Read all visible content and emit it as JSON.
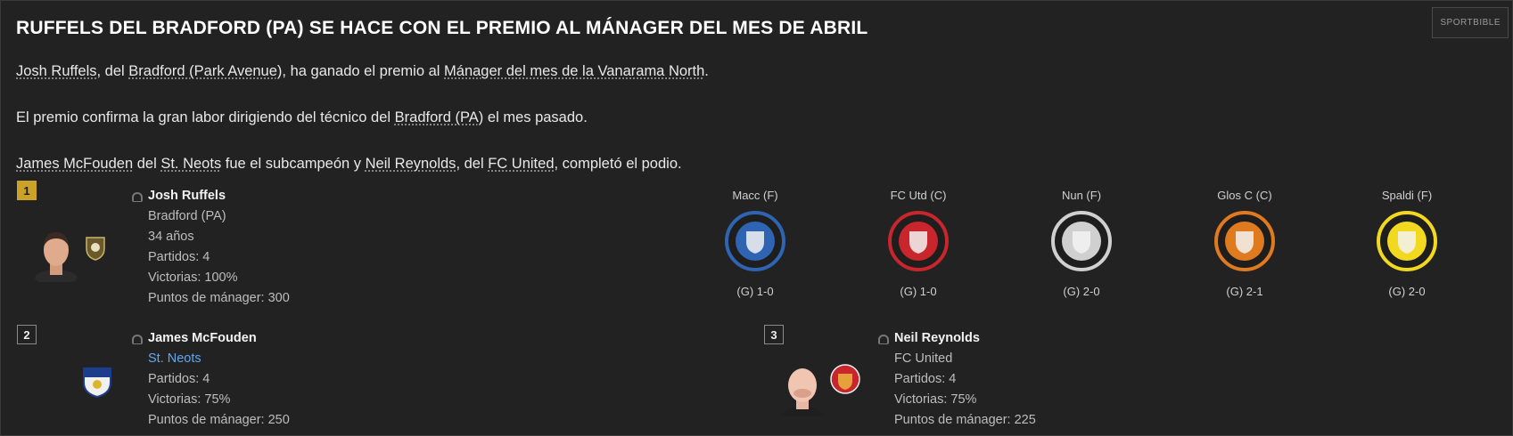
{
  "article": {
    "title": "RUFFELS DEL BRADFORD (PA) SE HACE CON EL PREMIO AL MÁNAGER DEL MES DE ABRIL",
    "source": "SPORTBIBLE",
    "para1": {
      "manager": "Josh Ruffels",
      "t1": ", del ",
      "club": "Bradford (Park Avenue)",
      "t2": ", ha ganado el premio al ",
      "award": "Mánager del mes de la Vanarama North",
      "t3": "."
    },
    "para2": {
      "t1": "El premio confirma la gran labor dirigiendo del técnico del ",
      "club": "Bradford (PA)",
      "t2": " el mes pasado."
    },
    "para3": {
      "m2": "James McFouden",
      "t1": " del ",
      "c2": "St. Neots",
      "t2": " fue el subcampeón y ",
      "m3": "Neil Reynolds",
      "t3": ", del ",
      "c3": "FC United",
      "t4": ", completó el podio."
    }
  },
  "winners": [
    {
      "rank": "1",
      "name": "Josh Ruffels",
      "club": "Bradford (PA)",
      "age": "34 años",
      "matches": "Partidos: 4",
      "wins": "Victorias: 100%",
      "points": "Puntos de mánager: 300"
    },
    {
      "rank": "2",
      "name": "James McFouden",
      "club": "St. Neots",
      "matches": "Partidos: 4",
      "wins": "Victorias: 75%",
      "points": "Puntos de mánager: 250"
    },
    {
      "rank": "3",
      "name": "Neil Reynolds",
      "club": "FC United",
      "matches": "Partidos: 4",
      "wins": "Victorias: 75%",
      "points": "Puntos de mánager: 225"
    }
  ],
  "fixtures": [
    {
      "opponent": "Macc (F)",
      "result": "(G) 1-0",
      "badge_color": "#2f64b2"
    },
    {
      "opponent": "FC Utd (C)",
      "result": "(G) 1-0",
      "badge_color": "#c8262c"
    },
    {
      "opponent": "Nun (F)",
      "result": "(G) 2-0",
      "badge_color": "#d0d0d0"
    },
    {
      "opponent": "Glos C (C)",
      "result": "(G) 2-1",
      "badge_color": "#e07a1f"
    },
    {
      "opponent": "Spaldi (F)",
      "result": "(G) 2-0",
      "badge_color": "#f2d81e"
    }
  ]
}
